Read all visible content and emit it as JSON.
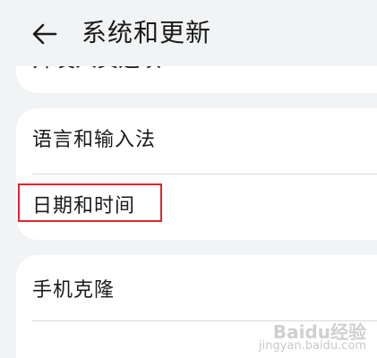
{
  "header": {
    "back_icon": "arrow-left-icon",
    "title": "系统和更新"
  },
  "cut_off_item": "开发人员选项",
  "group1": {
    "items": [
      {
        "label": "语言和输入法"
      },
      {
        "label": "日期和时间"
      }
    ]
  },
  "group2": {
    "items": [
      {
        "label": "手机克隆"
      }
    ]
  },
  "highlight_color": "#e0252a",
  "watermark": {
    "logo": "Baidu经验",
    "url": "jingyan.baidu.com"
  }
}
